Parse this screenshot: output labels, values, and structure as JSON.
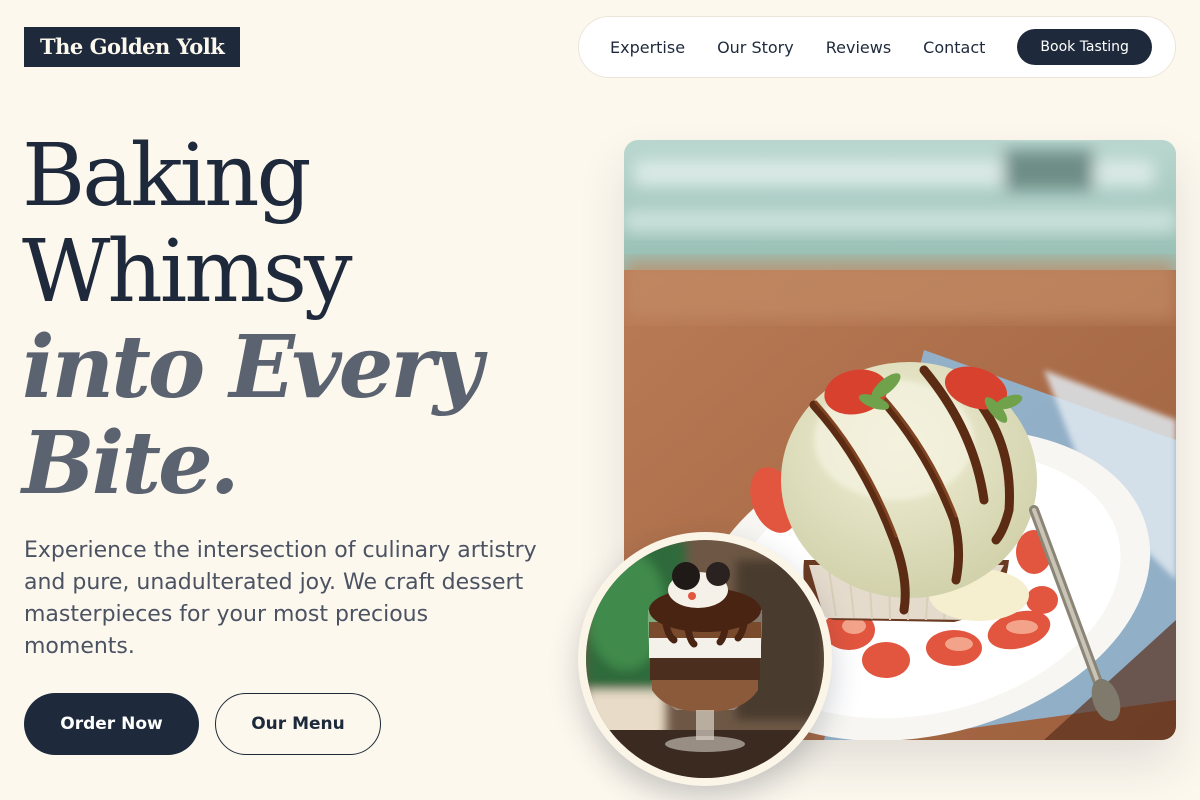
{
  "brand": {
    "name": "The Golden Yolk"
  },
  "nav": {
    "links": [
      "Expertise",
      "Our Story",
      "Reviews",
      "Contact"
    ],
    "cta_label": "Book Tasting"
  },
  "hero": {
    "headline_line1": "Baking",
    "headline_line2": "Whimsy",
    "headline_line3": "into Every",
    "headline_line4": "Bite.",
    "description": "Experience the intersection of culinary artistry and pure, unadulterated joy. We craft dessert masterpieces for your most precious moments.",
    "primary_button": "Order Now",
    "secondary_button": "Our Menu"
  },
  "colors": {
    "background": "#fdf8ee",
    "navy": "#1e2a3b",
    "slate_italic": "#5b6270",
    "body_text": "#4b5363"
  }
}
